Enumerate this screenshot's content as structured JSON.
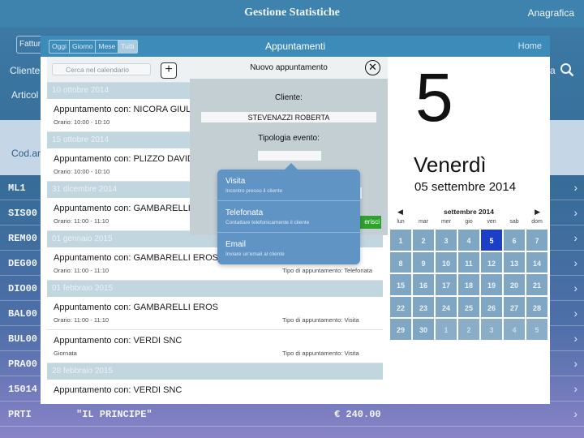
{
  "background": {
    "title": "Gestione Statistiche",
    "anagrafica": "Anagrafica",
    "fatt_label": "Fattur",
    "cliente_label": "Cliente",
    "articoli_label": "Articol",
    "search_partial": "a",
    "codart_label": "Cod.ar",
    "rows": [
      {
        "code": "ML1",
        "name": "",
        "price": ""
      },
      {
        "code": "SIS00",
        "name": "",
        "price": ""
      },
      {
        "code": "REM00",
        "name": "",
        "price": ""
      },
      {
        "code": "DEG00",
        "name": "",
        "price": ""
      },
      {
        "code": "DIO00",
        "name": "",
        "price": ""
      },
      {
        "code": "BAL00",
        "name": "",
        "price": ""
      },
      {
        "code": "BUL00",
        "name": "",
        "price": ""
      },
      {
        "code": "PRA00",
        "name": "",
        "price": ""
      },
      {
        "code": "15014",
        "name": "",
        "price": ""
      },
      {
        "code": "PRTI",
        "name": "\"IL PRINCIPE\"",
        "price": "€ 240.00"
      }
    ]
  },
  "modal": {
    "tabs": [
      "Oggi",
      "Giorno",
      "Mese",
      "Tutti"
    ],
    "active_tab": "Tutti",
    "title": "Appuntamenti",
    "home": "Home",
    "search_placeholder": "Cerca nel calendario",
    "add_label": "+",
    "groups": [
      {
        "date": "10 ottobre 2014",
        "items": [
          {
            "title": "Appuntamento con: NICORA GIUL",
            "time": "Orario: 10:00 - 10:10",
            "type": ""
          }
        ]
      },
      {
        "date": "15 ottobre 2014",
        "items": [
          {
            "title": "Appuntamento con: PLIZZO DAVID",
            "time": "Orario: 10:00 - 10:10",
            "type": ""
          }
        ]
      },
      {
        "date": "31 dicembre 2014",
        "items": [
          {
            "title": "Appuntamento con: GAMBARELLI",
            "time": "Orario: 11:00 - 11:10",
            "type": ""
          }
        ]
      },
      {
        "date": "01 gennaio 2015",
        "items": [
          {
            "title": "Appuntamento con: GAMBARELLI EROS",
            "time": "Orario: 11:00 - 11:10",
            "type": "Tipo di appuntamento: Telefonata"
          }
        ]
      },
      {
        "date": "01 febbraio 2015",
        "items": [
          {
            "title": "Appuntamento con: GAMBARELLI EROS",
            "time": "Orario: 11:00 - 11:10",
            "type": "Tipo di appuntamento: Visita"
          },
          {
            "title": "Appuntamento con: VERDI SNC",
            "time": "Giornata",
            "type": "Tipo di appuntamento: Visita"
          }
        ]
      },
      {
        "date": "28 febbraio 2015",
        "items": [
          {
            "title": "Appuntamento con: VERDI SNC",
            "time": "",
            "type": ""
          }
        ]
      }
    ]
  },
  "calendar": {
    "day_number": "5",
    "day_name": "Venerdì",
    "full_date": "05 settembre 2014",
    "month_label": "settembre 2014",
    "prev": "◀",
    "next": "▶",
    "dow": [
      "lun",
      "mar",
      "mer",
      "gio",
      "ven",
      "sab",
      "dom"
    ],
    "days": [
      {
        "d": "1",
        "dim": false
      },
      {
        "d": "2",
        "dim": false
      },
      {
        "d": "3",
        "dim": false
      },
      {
        "d": "4",
        "dim": false
      },
      {
        "d": "5",
        "dim": false,
        "selected": true
      },
      {
        "d": "6",
        "dim": false
      },
      {
        "d": "7",
        "dim": false
      },
      {
        "d": "8",
        "dim": false
      },
      {
        "d": "9",
        "dim": false
      },
      {
        "d": "10",
        "dim": false
      },
      {
        "d": "11",
        "dim": false
      },
      {
        "d": "12",
        "dim": false
      },
      {
        "d": "13",
        "dim": false
      },
      {
        "d": "14",
        "dim": false
      },
      {
        "d": "15",
        "dim": false
      },
      {
        "d": "16",
        "dim": false
      },
      {
        "d": "17",
        "dim": false
      },
      {
        "d": "18",
        "dim": false
      },
      {
        "d": "19",
        "dim": false
      },
      {
        "d": "20",
        "dim": false
      },
      {
        "d": "21",
        "dim": false
      },
      {
        "d": "22",
        "dim": false
      },
      {
        "d": "23",
        "dim": false
      },
      {
        "d": "24",
        "dim": false
      },
      {
        "d": "25",
        "dim": false
      },
      {
        "d": "26",
        "dim": false
      },
      {
        "d": "27",
        "dim": false
      },
      {
        "d": "28",
        "dim": false
      },
      {
        "d": "29",
        "dim": false
      },
      {
        "d": "30",
        "dim": false
      },
      {
        "d": "1",
        "dim": true
      },
      {
        "d": "2",
        "dim": true
      },
      {
        "d": "3",
        "dim": true
      },
      {
        "d": "4",
        "dim": true
      },
      {
        "d": "5",
        "dim": true
      }
    ],
    "selected_color": "#1b3fc8",
    "cell_color": "#7fa6c3"
  },
  "new_appointment": {
    "title": "Nuovo appuntamento",
    "close_label": "✕",
    "cliente_label": "Cliente:",
    "cliente_value": "STEVENAZZI ROBERTA",
    "tipologia_label": "Tipologia evento:",
    "insert_partial": "erisci",
    "options": [
      {
        "title": "Visita",
        "subtitle": "Incontro presso il cliente"
      },
      {
        "title": "Telefonata",
        "subtitle": "Contattare telefonicamente il cliente"
      },
      {
        "title": "Email",
        "subtitle": "Inviare un'email al cliente"
      }
    ]
  }
}
